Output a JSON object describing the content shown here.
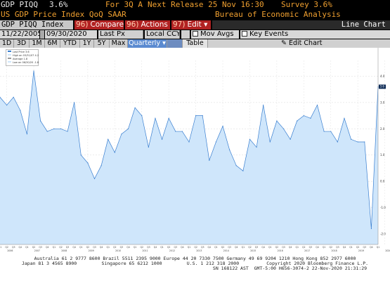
{
  "header": {
    "ticker": "GDP PIQQ",
    "value": "3.6%",
    "for_label": "For 3Q A",
    "next_release": "Next Release 25 Nov 16:30",
    "survey": "Survey 3.6%",
    "name": "US GDP Price Index QoQ SAAR",
    "source": "Bureau of Economic Analysis"
  },
  "toolbar": {
    "security": "GDP PIQQ Index",
    "compare_num": "96)",
    "compare_label": "Compare",
    "actions_num": "96)",
    "actions_label": "Actions ▾",
    "edit_num": "97)",
    "edit_label": "Edit ▾",
    "chart_type": "Line Chart"
  },
  "options": {
    "start_date": "11/22/2005",
    "end_date": "09/30/2020",
    "price_field": "Last Px",
    "currency": "Local CCY",
    "mov_avgs": "Mov Avgs",
    "key_events": "Key Events"
  },
  "periods": {
    "items": [
      "1D",
      "3D",
      "1M",
      "6M",
      "YTD",
      "1Y",
      "5Y",
      "Max"
    ],
    "frequency": "Quarterly ▾",
    "table": "Table",
    "edit_chart": "Edit Chart"
  },
  "legend": {
    "items": [
      {
        "label": "Last Price",
        "value": "3.6"
      },
      {
        "label": "High on 03/31/07",
        "value": "4.2"
      },
      {
        "label": "Average",
        "value": "1.8"
      },
      {
        "label": "Low on 06/30/20",
        "value": "-1.8"
      }
    ]
  },
  "footer": {
    "line1": "Australia 61 2 9777 8600 Brazil 5511 2395 9000 Europe 44 20 7330 7500 Germany 49 69 9204 1210 Hong Kong 852 2977 6000",
    "line2": "Japan 81 3 4565 8900         Singapore 65 6212 1000         U.S. 1 212 318 2000          Copyright 2020 Bloomberg Finance L.P.",
    "line3": "                                                                     SN 168122 AST  GMT-5:00 H656-3074-2 22-Nov-2020 21:31:29"
  },
  "chart_data": {
    "type": "area",
    "title": "",
    "xlabel": "",
    "ylabel": "",
    "ylim": [
      -2.4,
      4.6
    ],
    "grid": true,
    "legend_position": "top-left",
    "colors": {
      "fill": "#cfe6fb",
      "line": "#3a7fd0"
    },
    "y_ticks": [
      4.0,
      3.0,
      2.0,
      1.0,
      0.0,
      -1.0,
      -2.0
    ],
    "x_years": [
      "2006",
      "2007",
      "2008",
      "2009",
      "2010",
      "2011",
      "2012",
      "2013",
      "2014",
      "2015",
      "2016",
      "2017",
      "2018",
      "2019",
      "2020"
    ],
    "x_quarter_labels": [
      "Q1",
      "Q2",
      "Q3",
      "Q4"
    ],
    "last_value_label": "3.6",
    "values": [
      3.2,
      2.9,
      3.2,
      2.7,
      1.8,
      4.2,
      2.3,
      1.9,
      2.0,
      2.0,
      1.9,
      3.0,
      1.0,
      0.7,
      0.1,
      0.6,
      1.6,
      1.1,
      1.8,
      2.0,
      2.8,
      2.5,
      1.3,
      2.4,
      1.6,
      2.4,
      1.9,
      1.9,
      1.5,
      2.5,
      2.5,
      0.8,
      1.5,
      2.1,
      1.2,
      0.6,
      0.4,
      1.6,
      1.3,
      2.9,
      1.5,
      2.3,
      2.0,
      1.6,
      2.3,
      2.5,
      2.4,
      2.9,
      1.9,
      1.9,
      1.5,
      2.4,
      1.6,
      1.5,
      1.5,
      -1.8,
      3.6
    ]
  }
}
